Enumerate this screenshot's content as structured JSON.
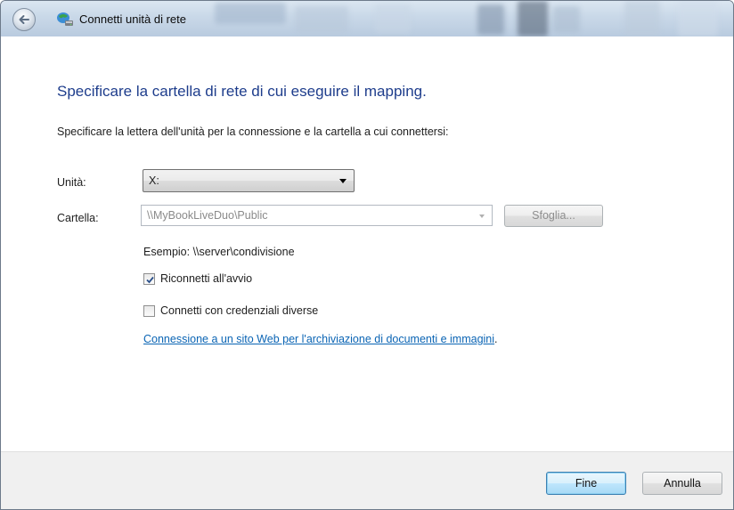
{
  "window": {
    "title": "Connetti unità di rete",
    "icons": {
      "back": "back-arrow-icon",
      "app": "network-drive-icon"
    }
  },
  "main": {
    "heading": "Specificare la cartella di rete di cui eseguire il mapping.",
    "instruction": "Specificare la lettera dell'unità per la connessione e la cartella a cui connettersi:",
    "drive": {
      "label": "Unità:",
      "value": "X:"
    },
    "folder": {
      "label": "Cartella:",
      "value": "\\\\MyBookLiveDuo\\Public",
      "browse_label": "Sfoglia..."
    },
    "example": "Esempio: \\\\server\\condivisione",
    "reconnect": {
      "label": "Riconnetti all'avvio",
      "checked": true
    },
    "credentials": {
      "label": "Connetti con credenziali diverse",
      "checked": false
    },
    "link": {
      "text": "Connessione a un sito Web per l'archiviazione di documenti e immagini",
      "suffix": "."
    }
  },
  "footer": {
    "finish_label": "Fine",
    "cancel_label": "Annulla"
  },
  "colors": {
    "heading": "#1e3d8c",
    "link": "#0a64b4",
    "footer_bg": "#f0f0f0",
    "default_button_border": "#3c7fb1"
  }
}
